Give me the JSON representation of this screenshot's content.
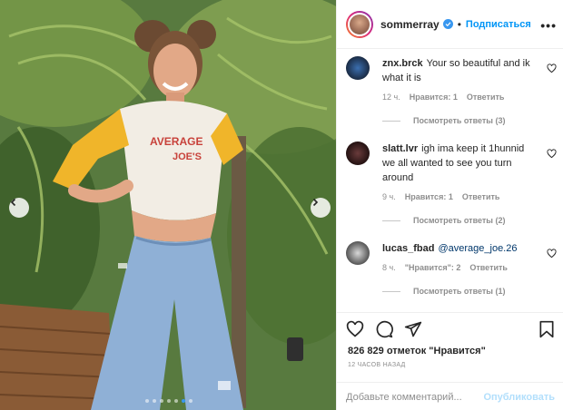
{
  "header": {
    "username": "sommerray",
    "separator": "•",
    "follow_label": "Подписаться",
    "more_label": "•••"
  },
  "comments": [
    {
      "username": "znx.brck",
      "text": "Your so beautiful and ik what it is",
      "time": "12 ч.",
      "likes_label": "Нравится: 1",
      "reply_label": "Ответить",
      "view_replies": "Посмотреть ответы (3)"
    },
    {
      "username": "slatt.lvr",
      "text": "igh ima keep it 1hunnid we all wanted to see you turn around",
      "time": "9 ч.",
      "likes_label": "Нравится: 1",
      "reply_label": "Ответить",
      "view_replies": "Посмотреть ответы (2)"
    },
    {
      "username": "lucas_fbad",
      "mention": "@average_joe.26",
      "time": "8 ч.",
      "likes_label": "\"Нравится\": 2",
      "reply_label": "Ответить",
      "view_replies": "Посмотреть ответы (1)"
    }
  ],
  "post": {
    "likes": "826 829 отметок \"Нравится\"",
    "time_ago": "12 часов назад"
  },
  "comment_box": {
    "placeholder": "Добавьте комментарий...",
    "publish_label": "Опубликовать"
  },
  "carousel": {
    "slide_count": 7,
    "active_index": 5
  },
  "colors": {
    "accent": "#0095f6",
    "verified": "#3897f0",
    "muted": "#8e8e8e"
  },
  "icons": [
    "chevron-left-icon",
    "chevron-right-icon",
    "verified-icon",
    "heart-icon",
    "comment-icon",
    "share-icon",
    "bookmark-icon"
  ]
}
